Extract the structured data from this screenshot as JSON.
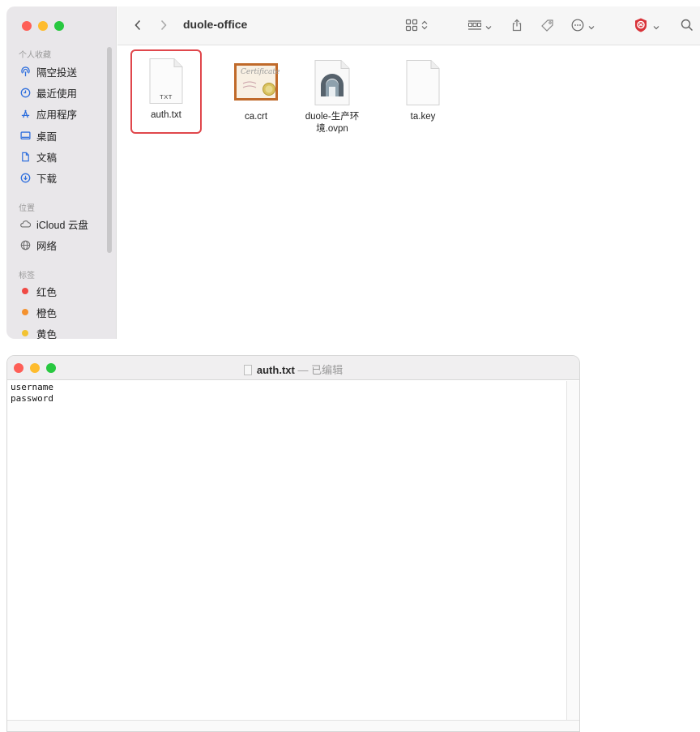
{
  "colors": {
    "close": "#fe5f57",
    "minimize": "#febc2e",
    "zoom": "#28c840",
    "selection": "#e0474c",
    "sidebar_icon": "#2f6fdd"
  },
  "finder": {
    "folder_title": "duole-office",
    "sidebar": {
      "favorites_header": "个人收藏",
      "favorites": [
        {
          "label": "隔空投送",
          "icon": "airdrop-icon"
        },
        {
          "label": "最近使用",
          "icon": "clock-icon"
        },
        {
          "label": "应用程序",
          "icon": "applications-icon"
        },
        {
          "label": "桌面",
          "icon": "desktop-icon"
        },
        {
          "label": "文稿",
          "icon": "document-icon"
        },
        {
          "label": "下载",
          "icon": "download-icon"
        }
      ],
      "locations_header": "位置",
      "locations": [
        {
          "label": "iCloud 云盘",
          "icon": "cloud-icon"
        },
        {
          "label": "网络",
          "icon": "globe-icon"
        }
      ],
      "tags_header": "标签",
      "tags": [
        {
          "label": "红色",
          "color": "#f04a45"
        },
        {
          "label": "橙色",
          "color": "#f4922f"
        },
        {
          "label": "黄色",
          "color": "#f2c333"
        }
      ]
    },
    "files": [
      {
        "name": "auth.txt",
        "icon": "txt-file-icon",
        "badge": "TXT",
        "selected": true
      },
      {
        "name": "ca.crt",
        "icon": "certificate-icon",
        "badge": "Certificate"
      },
      {
        "name": "duole-生产环\n境.ovpn",
        "icon": "ovpn-file-icon"
      },
      {
        "name": "ta.key",
        "icon": "blank-file-icon"
      }
    ]
  },
  "textedit": {
    "filename": "auth.txt",
    "separator": " — ",
    "status": "已编辑",
    "content": "username\npassword"
  }
}
